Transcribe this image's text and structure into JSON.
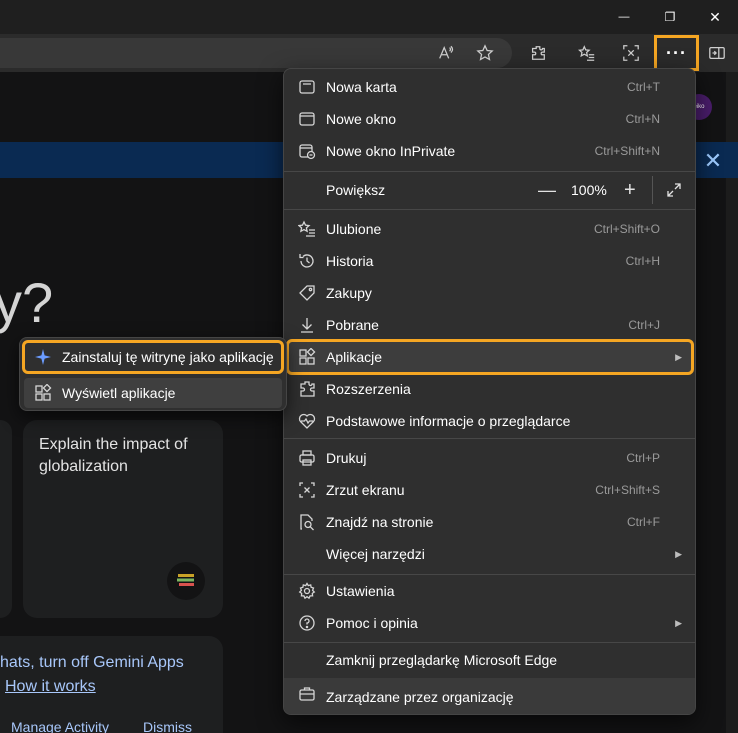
{
  "window": {
    "minimize_glyph": "—",
    "restore_glyph": "❐",
    "close_glyph": "✕"
  },
  "toolbar": {
    "more_label": "···",
    "icons": [
      "read-aloud-icon",
      "favorite-star-icon",
      "extensions-icon",
      "favorites-list-icon",
      "screenshot-icon",
      "more-icon",
      "sidebar-icon"
    ]
  },
  "page": {
    "big_text": "y?",
    "avatar_text": "eiko",
    "banner_close": "✕",
    "card_text": "Explain the impact of globalization",
    "bottom_line1": "hats, turn off Gemini Apps",
    "how_it_works": "How it works",
    "manage_activity": "Manage Activity",
    "dismiss": "Dismiss"
  },
  "menu": {
    "new_tab": {
      "label": "Nowa karta",
      "shortcut": "Ctrl+T"
    },
    "new_window": {
      "label": "Nowe okno",
      "shortcut": "Ctrl+N"
    },
    "new_inprivate": {
      "label": "Nowe okno InPrivate",
      "shortcut": "Ctrl+Shift+N"
    },
    "zoom": {
      "label": "Powiększ",
      "minus": "—",
      "value": "100%",
      "plus": "+"
    },
    "favorites": {
      "label": "Ulubione",
      "shortcut": "Ctrl+Shift+O"
    },
    "history": {
      "label": "Historia",
      "shortcut": "Ctrl+H"
    },
    "shopping": {
      "label": "Zakupy"
    },
    "downloads": {
      "label": "Pobrane",
      "shortcut": "Ctrl+J"
    },
    "apps": {
      "label": "Aplikacje",
      "arrow": "▶"
    },
    "extensions": {
      "label": "Rozszerzenia"
    },
    "browser_essentials": {
      "label": "Podstawowe informacje o przeglądarce"
    },
    "print": {
      "label": "Drukuj",
      "shortcut": "Ctrl+P"
    },
    "screenshot": {
      "label": "Zrzut ekranu",
      "shortcut": "Ctrl+Shift+S"
    },
    "find": {
      "label": "Znajdź na stronie",
      "shortcut": "Ctrl+F"
    },
    "more_tools": {
      "label": "Więcej narzędzi",
      "arrow": "▶"
    },
    "settings": {
      "label": "Ustawienia"
    },
    "help": {
      "label": "Pomoc i opinia",
      "arrow": "▶"
    },
    "close_edge": {
      "label": "Zamknij przeglądarkę Microsoft Edge"
    },
    "managed": {
      "label": "Zarządzane przez organizację"
    }
  },
  "submenu": {
    "install": {
      "label": "Zainstaluj tę witrynę jako aplikację"
    },
    "view_apps": {
      "label": "Wyświetl aplikacje"
    }
  },
  "colors": {
    "highlight": "#f5a623",
    "accent_blue": "#a8c7fa",
    "menu_bg": "#2f2f2f"
  }
}
